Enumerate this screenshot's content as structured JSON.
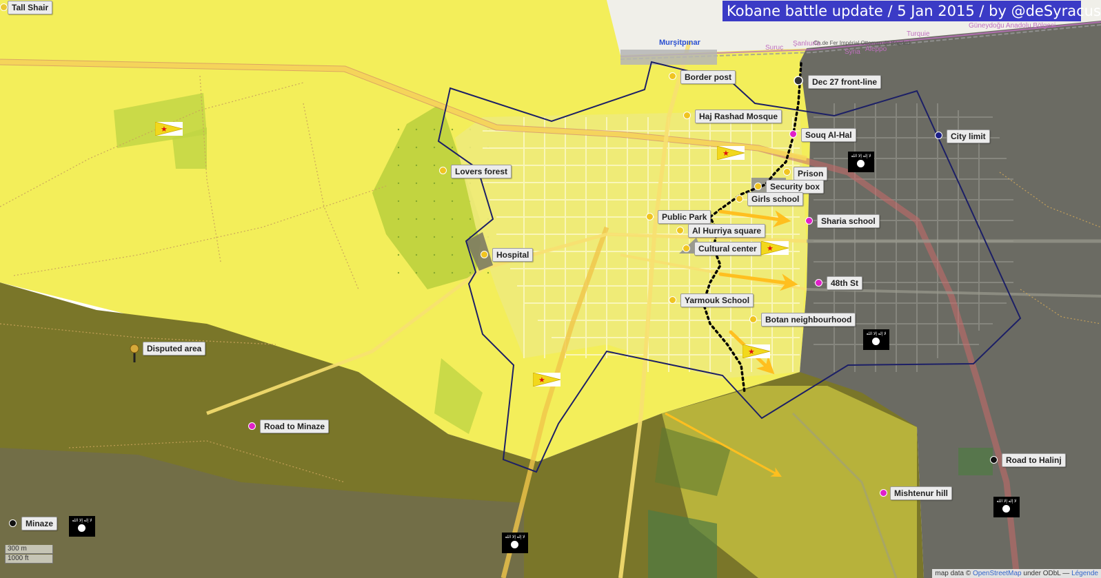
{
  "title": "Kobane battle update / 5 Jan 2015 / by @deSyracuse",
  "town_label": "Murşitpınar",
  "border_texts": [
    "Suruç",
    "Şanlıurfa",
    "Ch.de Fer Impérial Ottoman de Bagdad",
    "Turquie",
    "Syria",
    "Aleppo",
    "Güneydoğu Anadolu Bölgesi"
  ],
  "colors": {
    "kurdish_control": "#f3ee5a",
    "isis_control": "#7a7629",
    "disputed": "#c2bd3e",
    "city_outline": "#1c1f66",
    "front_line": "#000000",
    "arrow": "#ffbf1f",
    "title_bg": "#3b3bc6"
  },
  "labels": {
    "tall_shair": "Tall Shair",
    "border_post": "Border post",
    "dec27_frontline": "Dec 27 front-line",
    "haj_rashad_mosque": "Haj Rashad Mosque",
    "souq_al_hal": "Souq Al-Hal",
    "city_limit": "City limit",
    "lovers_forest": "Lovers forest",
    "prison": "Prison",
    "security_box": "Security box",
    "girls_school": "Girls school",
    "public_park": "Public Park",
    "sharia_school": "Sharia school",
    "al_hurriya_square": "Al Hurriya square",
    "cultural_center": "Cultural center",
    "hospital": "Hospital",
    "48th_st": "48th St",
    "yarmouk_school": "Yarmouk School",
    "botan_neighbourhood": "Botan neighbourhood",
    "disputed_area": "Disputed area",
    "road_to_minaze": "Road to Minaze",
    "road_to_halinj": "Road to Halinj",
    "mishtenur_hill": "Mishtenur hill",
    "minaze": "Minaze"
  },
  "flags": {
    "ypg_icon": "ypg-flag-icon",
    "isis_icon": "isis-flag-icon",
    "isis_script": "لا إله إلا الله"
  },
  "scale": {
    "metric": "300 m",
    "imperial": "1000 ft"
  },
  "attribution": {
    "prefix": "map data ©",
    "link": "OpenStreetMap",
    "suffix": "under ODbL —",
    "legend": "Légende"
  }
}
